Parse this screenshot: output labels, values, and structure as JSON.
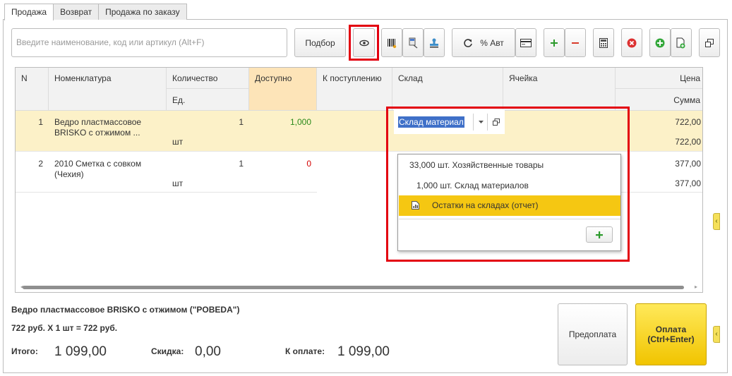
{
  "tabs": [
    "Продажа",
    "Возврат",
    "Продажа по заказу"
  ],
  "search": {
    "placeholder": "Введите наименование, код или артикул (Alt+F)"
  },
  "toolbar": {
    "podbor_label": "Подбор",
    "avt_label": "% Авт"
  },
  "columns": {
    "n": "N",
    "nomenclature": "Номенклатура",
    "quantity": "Количество",
    "unit": "Ед.",
    "available": "Доступно",
    "incoming": "К поступлению",
    "warehouse": "Склад",
    "cell": "Ячейка",
    "price": "Цена",
    "sum": "Сумма"
  },
  "rows": [
    {
      "n": "1",
      "name_line1": "Ведро пластмассовое",
      "name_line2": "BRISKO с отжимом ...",
      "qty": "1",
      "unit": "шт",
      "available": "1,000",
      "price": "722,00",
      "sum": "722,00"
    },
    {
      "n": "2",
      "name_line1": "2010 Сметка с совком",
      "name_line2": "(Чехия)",
      "qty": "1",
      "unit": "шт",
      "available": "0",
      "price": "377,00",
      "sum": "377,00"
    }
  ],
  "dropdown": {
    "selected": "Склад материал",
    "items": [
      "33,000 шт. Хозяйственные товары",
      "1,000 шт. Склад материалов",
      "Остатки на складах (отчет)"
    ]
  },
  "footer": {
    "product": "Ведро пластмассовое BRISKO с отжимом (\"POBEDA\")",
    "calc": "722 руб. X 1 шт = 722 руб.",
    "total_label": "Итого:",
    "total_value": "1 099,00",
    "discount_label": "Скидка:",
    "discount_value": "0,00",
    "topay_label": "К оплате:",
    "topay_value": "1 099,00",
    "prepay_label": "Предоплата",
    "pay_line1": "Оплата",
    "pay_line2": "(Ctrl+Enter)"
  },
  "colors": {
    "accent_yellow": "#f5c712",
    "highlight_red": "#e3000f",
    "row_selected": "#fcf1c8",
    "available_green": "#2a8a1a",
    "available_red": "#d40000"
  }
}
